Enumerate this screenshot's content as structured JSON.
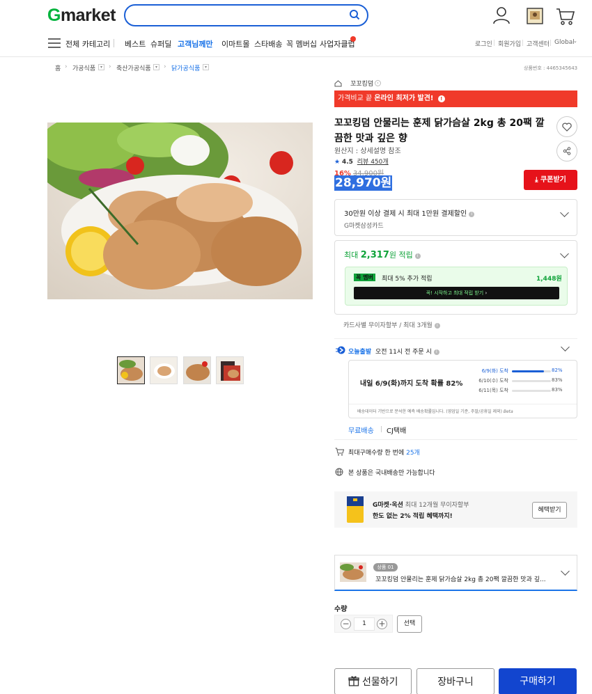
{
  "header": {
    "logo_g": "G",
    "logo_rest": "market",
    "search_placeholder": "",
    "icons": [
      "user-icon",
      "myshop-icon",
      "cart-icon"
    ]
  },
  "gnb": {
    "menu_label": "전체 카테고리",
    "items": [
      "베스트",
      "슈퍼딜",
      "고객님께만",
      "이마트몰",
      "스타배송",
      "꼭 멤버십",
      "사업자클럽"
    ],
    "highlighted": "고객님께만",
    "util": [
      "로그인",
      "회원가입",
      "고객센터",
      "Global"
    ]
  },
  "breadcrumb": {
    "items": [
      "홈",
      "가공식품",
      "축산가공식품",
      "닭가공식품"
    ],
    "product_no": "상품번호 : 4465345643"
  },
  "product": {
    "store": "꼬꼬킹덤",
    "price_banner": {
      "prefix": "가격비교 끝 ",
      "bold": "온라인 최저가 발견!",
      "icon": "!"
    },
    "title": "꼬꼬킹덤 안물리는 훈제 닭가슴살 2kg 총 20팩 깔끔한 맛과 깊은 향",
    "origin": "원산지 : 상세설명 참조",
    "rating": "4.5",
    "review_text": "리뷰 450개",
    "discount_pct": "16%",
    "orig_price": "34,900원",
    "price": "28,970원",
    "coupon_label": "쿠폰받기"
  },
  "benefits": {
    "card_line1": "30만원 이상 결제 시 최대 1만원 결제할인",
    "card_line2": "G마켓삼성카드",
    "points_prefix": "최대 ",
    "points_value": "2,317",
    "points_suffix": "원 적립",
    "member_badge": "꼭 멤버",
    "member_text": "최대 5% 추가 적립",
    "member_points": "1,448원",
    "member_bar_pre": "꼭! 시작하고 최대 적립 받기",
    "member_bar_arrow": "›",
    "installment": "카드사별 무이자할부 / 최대 3개월"
  },
  "delivery": {
    "today_label": "오늘출발",
    "today_text": "오전 11시 전 주문 시",
    "headline": "내일 6/9(화)까지 도착 확률 82%",
    "rows": [
      {
        "label": "6/9(화) 도착",
        "pct": "82%",
        "value": 0.82,
        "highlight": true
      },
      {
        "label": "6/10(수) 도착",
        "pct": "83%",
        "value": 0.83,
        "highlight": false
      },
      {
        "label": "6/11(목) 도착",
        "pct": "83%",
        "value": 0.83,
        "highlight": false
      }
    ],
    "note": "배송데이터 기반으로 분석한 예측 배송확률입니다. (영업일 기준, 주말/공휴일 제외)",
    "note_beta": "Beta",
    "free": "무료배송",
    "carrier": "CJ택배",
    "max_qty_prefix": "최대구매수량 한 번에 ",
    "max_qty_value": "25개",
    "domestic": "본 상품은 국내배송만 가능합니다"
  },
  "card_promo": {
    "line1_bold": "G마켓·옥션",
    "line1_rest": " 최대 12개월 무이자할부",
    "line2": "한도 없는 2% 적립 혜택까지!",
    "button": "혜택받기"
  },
  "option": {
    "badge": "상품 01",
    "text": "꼬꼬킹덤 안물리는 훈제 닭가슴살 2kg 총 20팩 깔끔한 맛과 깊..."
  },
  "quantity": {
    "label": "수량",
    "value": "1",
    "select_label": "선택"
  },
  "actions": {
    "gift": "선물하기",
    "cart": "장바구니",
    "buy": "구매하기"
  },
  "colors": {
    "brand_green": "#00b33c",
    "accent_blue": "#1a5fd6",
    "sale_red": "#f03a2a",
    "buy_navy": "#1245cf"
  }
}
